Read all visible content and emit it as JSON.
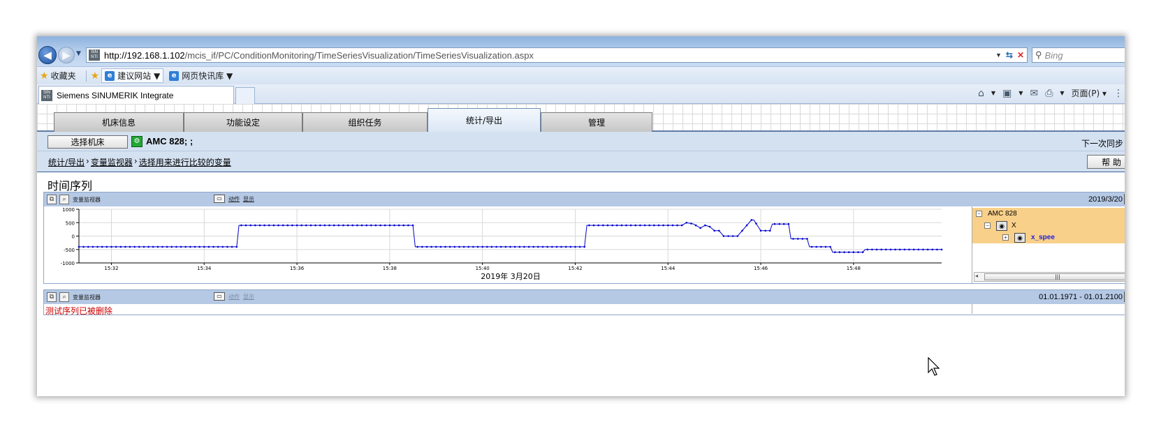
{
  "browser": {
    "url_host": "http://192.168.1.102",
    "url_path": "/mcis_if/PC/ConditionMonitoring/TimeSeriesVisualization/TimeSeriesVisualization.aspx",
    "search_placeholder": "Bing",
    "favorites_label": "收藏夹",
    "suggested_sites_label": "建议网站 ▼",
    "web_slice_label": "网页快讯库 ▼",
    "tab_title": "Siemens SINUMERIK Integrate",
    "page_menu_label": "页面(P) ▾"
  },
  "app": {
    "tabs": [
      {
        "label": "机床信息"
      },
      {
        "label": "功能设定"
      },
      {
        "label": "组织任务"
      },
      {
        "label": "统计/导出",
        "active": true
      },
      {
        "label": "管理"
      }
    ],
    "select_machine_label": "选择机床",
    "machine_name": "AMC 828; ;",
    "next_sync_label": "下一次同步",
    "breadcrumb": [
      "统计/导出",
      "变量监视器",
      "选择用来进行比较的变量"
    ],
    "breadcrumb_sep": "›",
    "help_label": "帮 助",
    "page_title": "时间序列"
  },
  "panel1": {
    "title": "变量监视器",
    "action_label": "动作",
    "display_label": "显示",
    "date": "2019/3/20",
    "tree": {
      "machine": "AMC 828",
      "axis": "X",
      "variable": "x_spee"
    }
  },
  "panel2": {
    "title": "变量监视器",
    "action_label": "动作",
    "display_label": "显示",
    "date_range": "01.01.1971 - 01.01.2100",
    "error_message": "测试序列已被删除"
  },
  "chart_data": {
    "type": "line",
    "xlabel": "2019年 3月20日",
    "ylabel": "",
    "ylim": [
      -1000,
      1000
    ],
    "yticks": [
      "1000",
      "500",
      "0",
      "-500",
      "-1000"
    ],
    "xticks": [
      "15:32",
      "15:34",
      "15:36",
      "15:38",
      "15:40",
      "15:42",
      "15:44",
      "15:46",
      "15:48"
    ],
    "x_start_minutes": 31.3,
    "x_end_minutes": 49.9,
    "series": [
      {
        "color": "#0000cc",
        "x": [
          31.3,
          34.7,
          34.75,
          38.5,
          38.55,
          42.2,
          42.25,
          44.3,
          44.4,
          44.55,
          44.7,
          44.8,
          44.9,
          45.0,
          45.1,
          45.2,
          45.4,
          45.5,
          45.8,
          45.85,
          46.0,
          46.2,
          46.25,
          46.6,
          46.65,
          47.0,
          47.05,
          47.5,
          47.55,
          48.2,
          48.25,
          49.9
        ],
        "y": [
          -400,
          -400,
          400,
          400,
          -400,
          -400,
          400,
          400,
          500,
          450,
          300,
          400,
          350,
          200,
          200,
          0,
          0,
          0,
          600,
          600,
          200,
          200,
          450,
          450,
          -100,
          -100,
          -400,
          -400,
          -600,
          -600,
          -500,
          -500
        ]
      }
    ]
  }
}
